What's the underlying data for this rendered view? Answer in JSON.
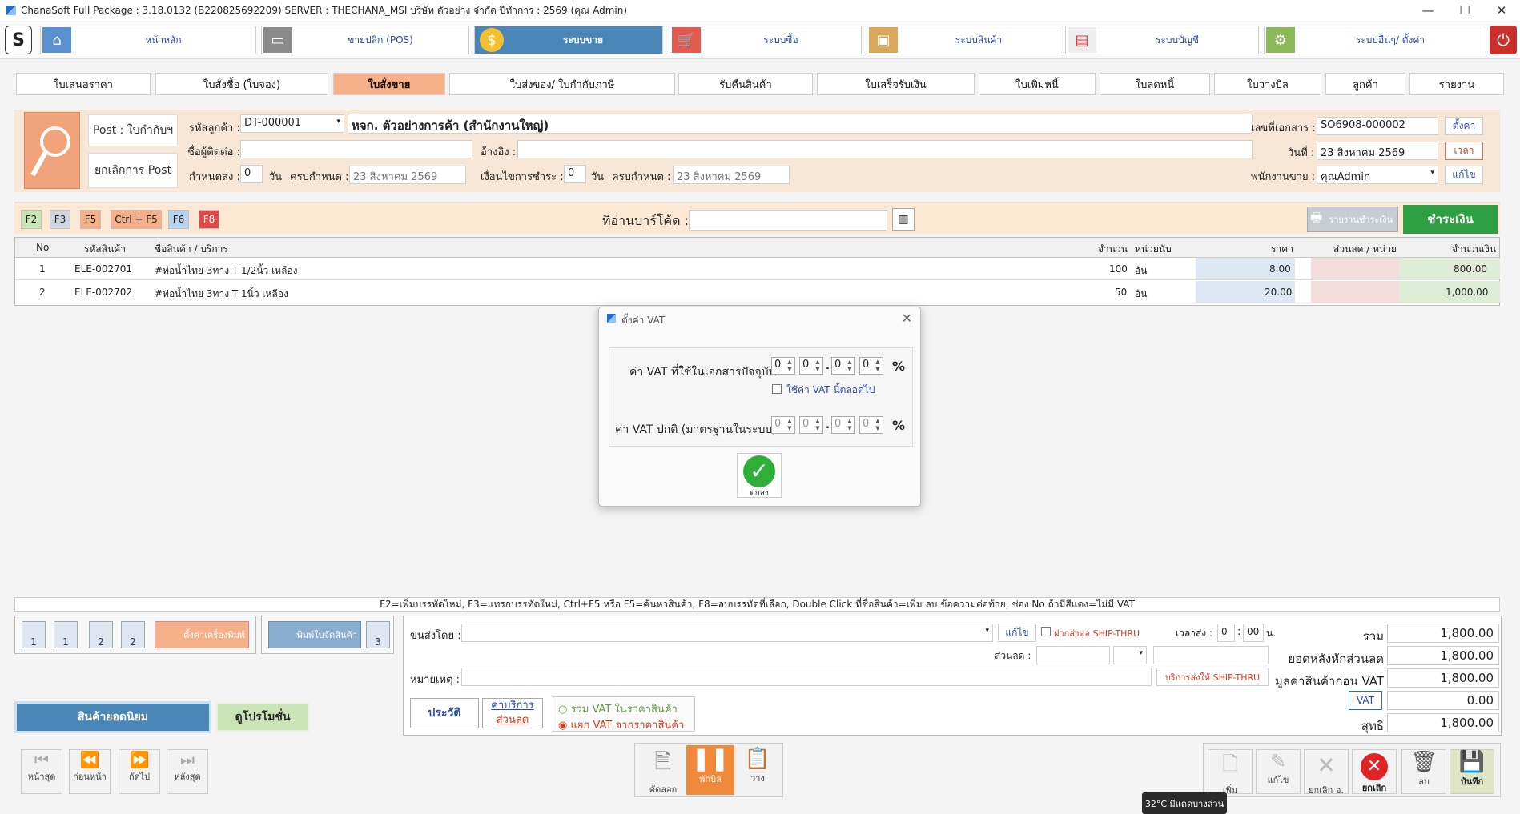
{
  "window": {
    "title": "ChanaSoft Full Package : 3.18.0132 (B220825692209) SERVER : THECHANA_MSI บริษัท ตัวอย่าง จำกัด ปีทำการ : 2569 (คุณ Admin)",
    "controls": [
      "—",
      "☐",
      "✕"
    ]
  },
  "modules": [
    {
      "label": "หน้าหลัก",
      "icon": "home-icon",
      "active": false
    },
    {
      "label": "ขายปลีก (POS)",
      "icon": "pos-icon",
      "active": false
    },
    {
      "label": "ระบบขาย",
      "icon": "coin-icon",
      "active": true
    },
    {
      "label": "ระบบซื้อ",
      "icon": "cart-icon",
      "active": false
    },
    {
      "label": "ระบบสินค้า",
      "icon": "box-icon",
      "active": false
    },
    {
      "label": "ระบบบัญชี",
      "icon": "ledger-icon",
      "active": false
    },
    {
      "label": "ระบบอื่นๆ/ ตั้งค่า",
      "icon": "gear-icon",
      "active": false
    }
  ],
  "tabs": [
    "ใบเสนอราคา",
    "ใบสั่งซื้อ (ใบจอง)",
    "ใบสั่งขาย",
    "ใบส่งของ/ ใบกำกับภาษี",
    "รับคืนสินค้า",
    "ใบเสร็จรับเงิน",
    "ใบเพิ่มหนี้",
    "ใบลดหนี้",
    "ใบวางบิล",
    "ลูกค้า",
    "รายงาน"
  ],
  "header": {
    "post_button": "Post : ใบกำกับฯ",
    "cancel_post_button": "ยกเลิกการ Post",
    "customer_code_label": "รหัสลูกค้า :",
    "customer_code": "DT-000001",
    "customer_name": "หจก. ตัวอย่างการค้า (สำนักงานใหญ่)",
    "contact_label": "ชื่อผู้ติดต่อ :",
    "reference_label": "อ้างอิง :",
    "delivery_label": "กำหนดส่ง :",
    "delivery_days": "0",
    "days_unit": "วัน",
    "due_label": "ครบกำหนด :",
    "due_date_1": "23   สิงหาคม    2569",
    "payment_terms_label": "เงื่อนไขการชำระ :",
    "payment_days": "0",
    "due_date_2": "23   สิงหาคม    2569",
    "docno_label": "เลขที่เอกสาร :",
    "docno": "SO6908-000002",
    "set_button": "ตั้งค่า",
    "date_label": "วันที่ :",
    "date_value": "23  สิงหาคม    2569",
    "time_button": "เวลา",
    "salesman_label": "พนักงานขาย :",
    "salesman": "คุณAdmin",
    "edit_button": "แก้ไข"
  },
  "toolbar": {
    "keys": [
      "F2",
      "F3",
      "F5",
      "Ctrl + F5",
      "F6",
      "F8"
    ],
    "barcode_label": "ที่อ่านบาร์โค้ด :",
    "print_receipt": "รายงานชำระเงิน",
    "pay_button": "ชำระเงิน"
  },
  "grid": {
    "columns": [
      "No",
      "รหัสสินค้า",
      "ชื่อสินค้า / บริการ",
      "จำนวน",
      "หน่วยนับ",
      "ราคา",
      "ส่วนลด / หน่วย",
      "จำนวนเงิน"
    ],
    "rows": [
      {
        "no": "1",
        "code": "ELE-002701",
        "name": "#ท่อน้ำไทย 3ทาง T 1/2นิ้ว เหลือง",
        "qty": "100",
        "unit": "อัน",
        "price": "8.00",
        "discount": "",
        "amount": "800.00"
      },
      {
        "no": "2",
        "code": "ELE-002702",
        "name": "#ท่อน้ำไทย 3ทาง T 1นิ้ว เหลือง",
        "qty": "50",
        "unit": "อัน",
        "price": "20.00",
        "discount": "",
        "amount": "1,000.00"
      }
    ]
  },
  "hint": "F2=เพิ่มบรรทัดใหม่,   F3=แทรกบรรทัดใหม่,   Ctrl+F5 หรือ F5=ค้นหาสินค้า,   F8=ลบบรรทัดที่เลือก,   Double Click ที่ชื่อสินค้า=เพิ่ม ลบ ข้อความต่อท้าย,   ช่อง No ถ้ามีสีแดง=ไม่มี VAT",
  "print": {
    "labels": [
      "1",
      "1",
      "2",
      "2"
    ],
    "printer_settings": "ตั้งค่าเครื่องพิมพ์",
    "print_picking": "พิมพ์ใบจัดสินค้า",
    "p3": "3",
    "p3b": "3"
  },
  "left_actions": {
    "popular": "สินค้ายอดนิยม",
    "promotion": "ดูโปรโมชั่น"
  },
  "nav": [
    "หน้าสุด",
    "ก่อนหน้า",
    "ถัดไป",
    "หลังสุด"
  ],
  "bottom": {
    "ship_by_label": "ขนส่งโดย :",
    "ship_edit": "แก้ไข",
    "ship_thru_label": "ฝากส่งต่อ SHIP-THRU",
    "ship_time_label": "เวลาส่ง :",
    "ship_hour": "0",
    "ship_min": "00",
    "ship_unit": "น.",
    "discount_label": "ส่วนลด :",
    "remark_label": "หมายเหตุ :",
    "ship_thru_service": "บริการส่งให้ SHIP-THRU",
    "history": "ประวัติ",
    "service_fee": "ค่าบริการ",
    "discount_link": "ส่วนลด",
    "vat_incl": "รวม VAT ในราคาสินค้า",
    "vat_excl": "แยก VAT จากราคาสินค้า"
  },
  "summary": {
    "total_label": "รวม",
    "total": "1,800.00",
    "after_discount_label": "ยอดหลังหักส่วนลด",
    "after_discount": "1,800.00",
    "before_vat_label": "มูลค่าสินค้าก่อน VAT",
    "before_vat": "1,800.00",
    "vat_label": "VAT",
    "vat": "0.00",
    "net_label": "สุทธิ",
    "net": "1,800.00"
  },
  "center_actions": {
    "copy": "คัดลอก",
    "pause": "พักบิล",
    "paste": "วาง"
  },
  "right_actions": {
    "add": "เพิ่ม",
    "edit": "แก้ไข",
    "cancel_doc": "ยกเลิก อ.",
    "cancel": "ยกเลิก",
    "delete": "ลบ",
    "save": "บันทึก"
  },
  "tooltip": "32°C มีแดดบางส่วน",
  "dialog": {
    "title": "ตั้งค่า VAT",
    "current_vat_label": "ค่า VAT ที่ใช้ในเอกสารปัจจุบัน",
    "current_digits": [
      "0",
      "0",
      "0",
      "0"
    ],
    "use_vat_next": "ใช้ค่า VAT นี้ตลอดไป",
    "default_vat_label": "ค่า VAT ปกติ (มาตรฐานในระบบ)",
    "default_digits": [
      "0",
      "0",
      "0",
      "0"
    ],
    "percent": "%",
    "ok": "ตกลง"
  }
}
